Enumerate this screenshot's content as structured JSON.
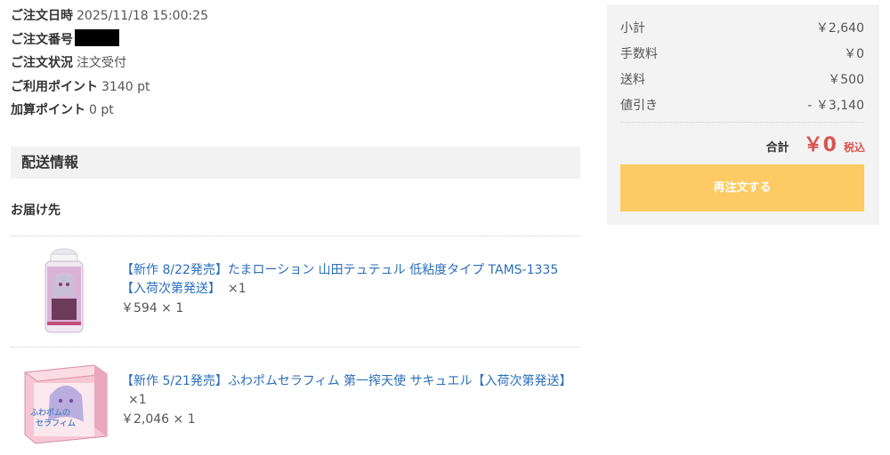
{
  "order": {
    "date_label": "ご注文日時",
    "date_value": "2025/11/18 15:00:25",
    "number_label": "ご注文番号",
    "status_label": "ご注文状況",
    "status_value": "注文受付",
    "points_used_label": "ご利用ポイント",
    "points_used_value": "3140 pt",
    "points_added_label": "加算ポイント",
    "points_added_value": "0 pt"
  },
  "shipping": {
    "section_title": "配送情報",
    "destination_label": "お届け先"
  },
  "items": [
    {
      "name": "【新作 8/22発売】たまローション 山田テュテュル 低粘度タイプ TAMS-1335【入荷次第発送】",
      "qty": "×1",
      "price": "￥594 × 1"
    },
    {
      "name": "【新作 5/21発売】ふわポムセラフィム 第一搾天使 サキュエル【入荷次第発送】",
      "qty": "×1",
      "price": "￥2,046 × 1",
      "box_text_1": "ふわポムの",
      "box_text_2": "セラフィム"
    }
  ],
  "summary": {
    "subtotal_label": "小計",
    "subtotal_value": "￥2,640",
    "fee_label": "手数料",
    "fee_value": "￥0",
    "shipping_label": "送料",
    "shipping_value": "￥500",
    "discount_label": "値引き",
    "discount_value": "- ￥3,140",
    "total_label": "合計",
    "total_value": "￥0",
    "tax_label": "税込",
    "reorder_label": "再注文する"
  },
  "colors": {
    "accent_price": "#d9534f",
    "reorder_button": "#fdca63",
    "link": "#2a6ebb"
  }
}
